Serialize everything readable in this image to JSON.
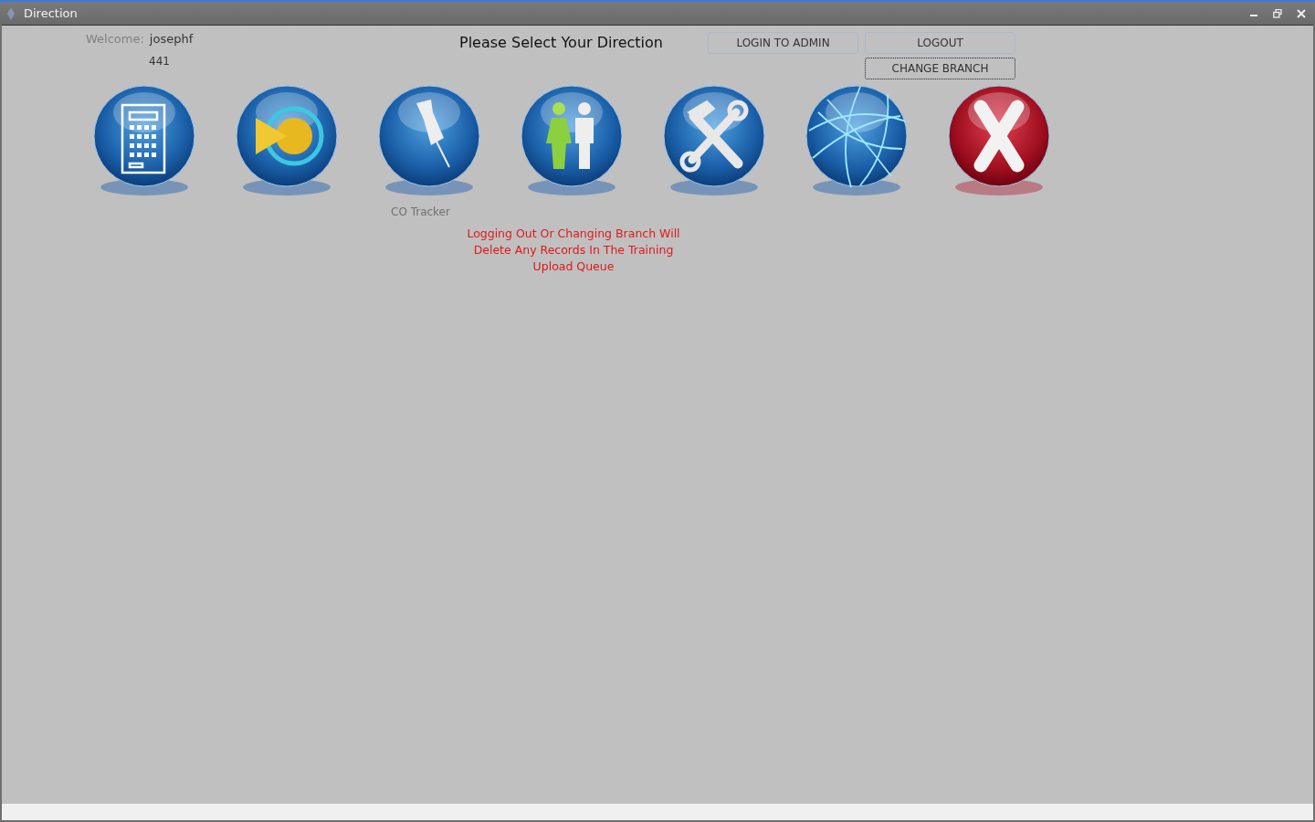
{
  "window": {
    "title": "Direction"
  },
  "user": {
    "welcome_label": "Welcome:",
    "username": "josephf",
    "branch": "441"
  },
  "heading": "Please Select Your Direction",
  "buttons": [
    {
      "label": "LOGIN TO ADMIN",
      "focused": false
    },
    {
      "label": "LOGOUT",
      "focused": false
    },
    {
      "label": "CHANGE BRANCH",
      "focused": true
    }
  ],
  "tiles": [
    {
      "kind": "calculator"
    },
    {
      "kind": "play"
    },
    {
      "kind": "pin",
      "label": "CO Tracker"
    },
    {
      "kind": "people"
    },
    {
      "kind": "tools"
    },
    {
      "kind": "globe"
    },
    {
      "kind": "exit"
    }
  ],
  "warning": "Logging Out Or Changing Branch Will Delete Any Records In The Training Upload Queue"
}
